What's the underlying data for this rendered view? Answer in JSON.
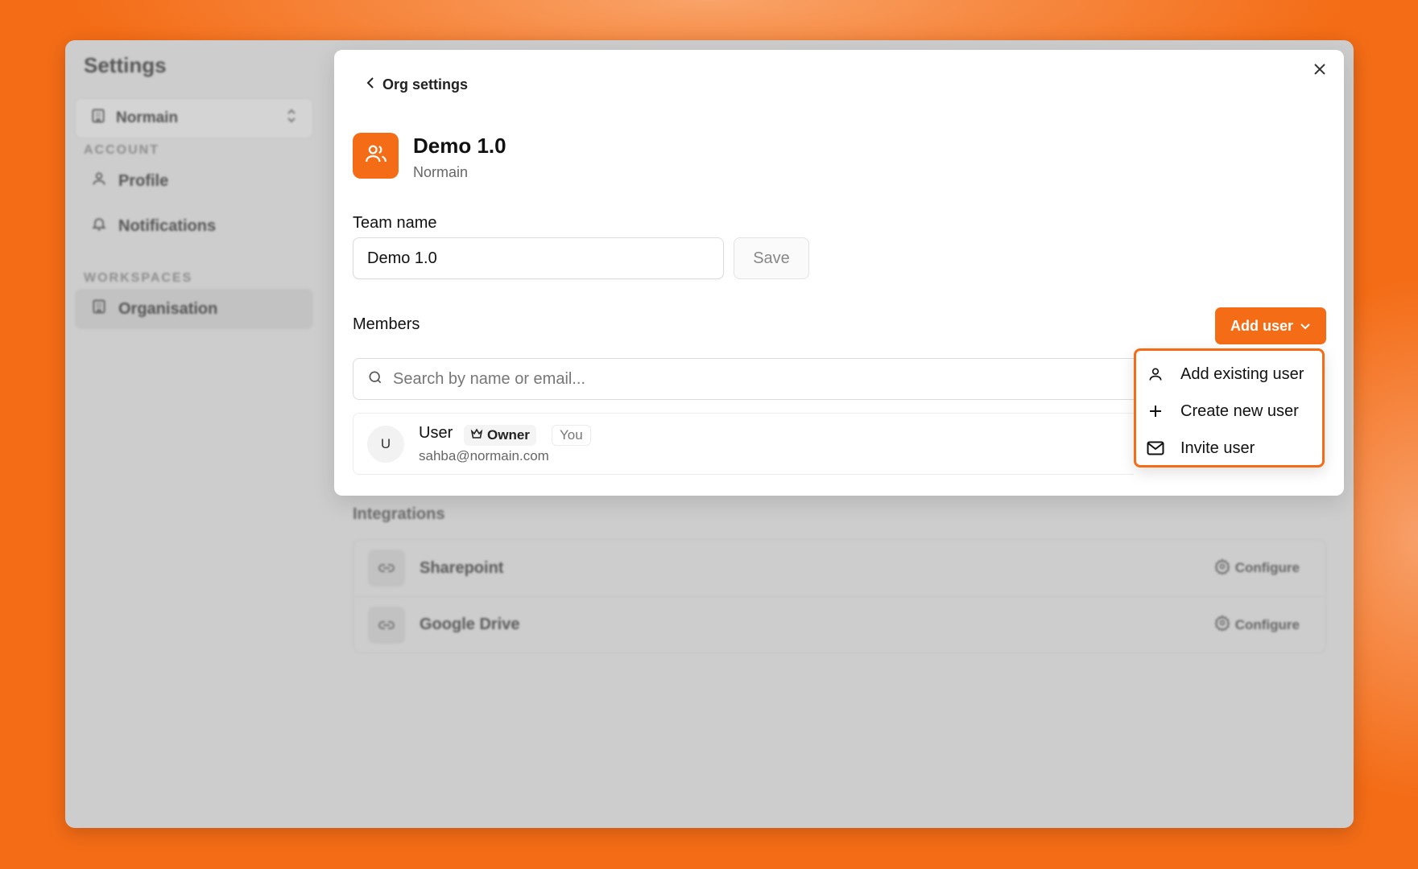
{
  "sidebar": {
    "title": "Settings",
    "workspace": "Normain",
    "sections": [
      {
        "label": "ACCOUNT",
        "items": [
          "Profile",
          "Notifications"
        ]
      },
      {
        "label": "WORKSPACES",
        "items": [
          "Organisation"
        ]
      }
    ]
  },
  "integrations": {
    "title": "Integrations",
    "items": [
      {
        "name": "Sharepoint",
        "action": "Configure"
      },
      {
        "name": "Google Drive",
        "action": "Configure"
      }
    ]
  },
  "modal": {
    "back_label": "Org settings",
    "team_title": "Demo 1.0",
    "team_org": "Normain",
    "team_name_label": "Team name",
    "team_name_value": "Demo 1.0",
    "save_label": "Save",
    "members_label": "Members",
    "add_user_label": "Add user",
    "search_placeholder": "Search by name or email...",
    "members": [
      {
        "initial": "U",
        "name": "User",
        "role": "Owner",
        "tag": "You",
        "email": "sahba@normain.com"
      }
    ]
  },
  "dropdown": {
    "items": [
      {
        "label": "Add existing user",
        "icon": "user-icon"
      },
      {
        "label": "Create new user",
        "icon": "plus-icon"
      },
      {
        "label": "Invite user",
        "icon": "mail-icon"
      }
    ]
  },
  "colors": {
    "accent": "#f46c16"
  }
}
